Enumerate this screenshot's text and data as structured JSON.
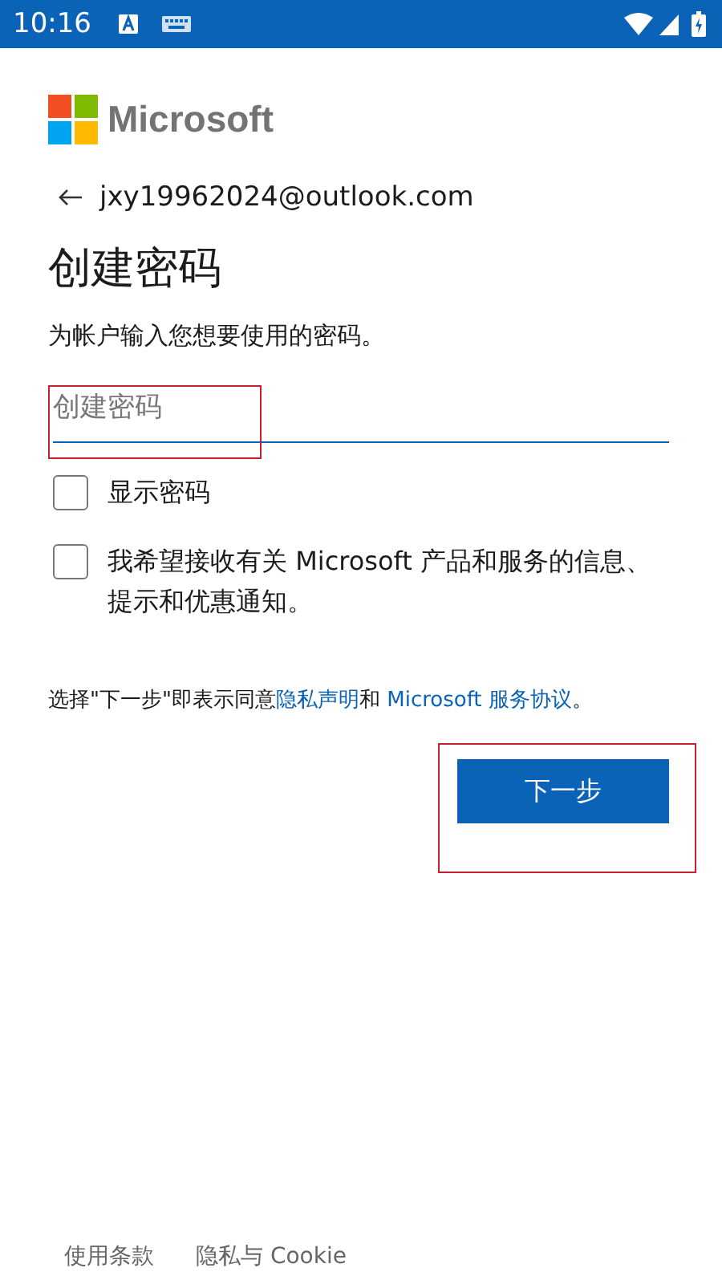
{
  "status_bar": {
    "time": "10:16"
  },
  "logo": {
    "text": "Microsoft"
  },
  "account": {
    "email": "jxy19962024@outlook.com"
  },
  "title": "创建密码",
  "subtitle": "为帐户输入您想要使用的密码。",
  "password_field": {
    "placeholder": "创建密码"
  },
  "checkboxes": [
    {
      "label": "显示密码",
      "checked": false
    },
    {
      "label": "我希望接收有关 Microsoft 产品和服务的信息、提示和优惠通知。",
      "checked": false
    }
  ],
  "consent": [
    {
      "kind": "text",
      "text": "选择\"下一步\"即表示同意"
    },
    {
      "kind": "link",
      "text": "隐私声明"
    },
    {
      "kind": "text",
      "text": "和 "
    },
    {
      "kind": "link",
      "text": "Microsoft 服务协议"
    },
    {
      "kind": "text",
      "text": "。"
    }
  ],
  "next_button": "下一步",
  "footer_links": [
    "使用条款",
    "隐私与 Cookie"
  ]
}
